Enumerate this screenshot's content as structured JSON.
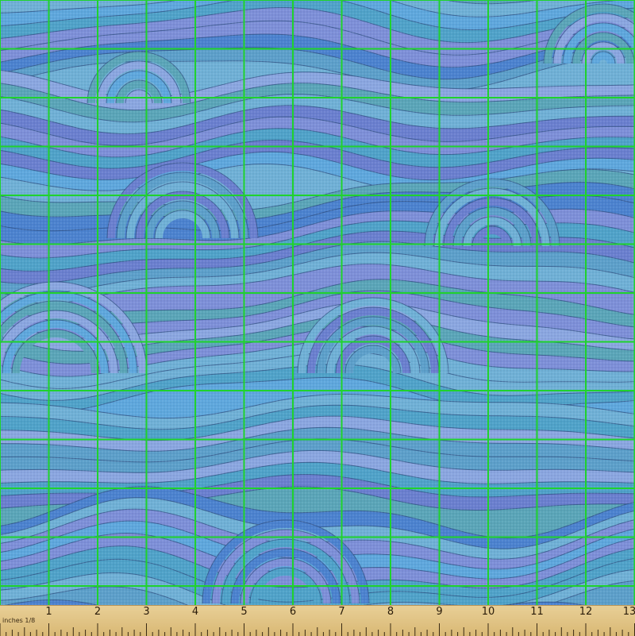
{
  "fabric": {
    "colors": [
      "#4b82cf",
      "#5ea7dd",
      "#6fb0d6",
      "#7d8fd8",
      "#5aa5b8",
      "#6a7fcf",
      "#4fa2c9",
      "#8aa6e0",
      "#5c9fca"
    ],
    "outline_color": "#2f4f80",
    "grid_color": "#1fd22d",
    "grid_columns": 13,
    "grid_rows": 12
  },
  "ruler": {
    "unit_label": "inches 1/8",
    "numbers": [
      "1",
      "2",
      "3",
      "4",
      "5",
      "6",
      "7",
      "8",
      "9",
      "10",
      "11",
      "12",
      "13"
    ]
  }
}
